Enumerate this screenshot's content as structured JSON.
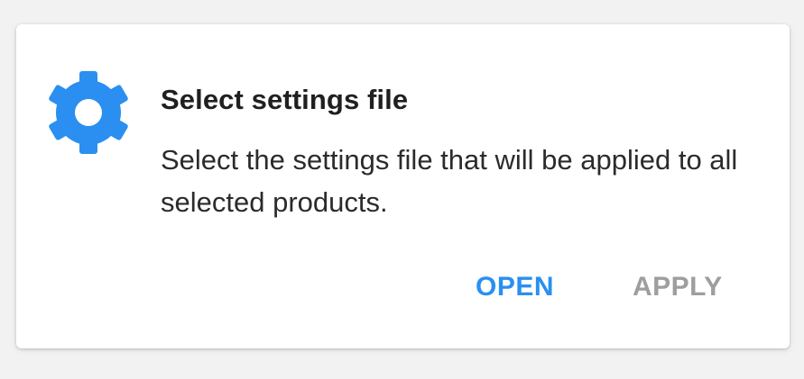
{
  "dialog": {
    "icon": "gear-icon",
    "title": "Select settings file",
    "message": "Select the settings file that will be applied to all selected products.",
    "buttons": {
      "open_label": "OPEN",
      "apply_label": "APPLY"
    }
  },
  "colors": {
    "accent": "#2a8ff0",
    "disabled": "#9e9e9e",
    "title_text": "#202020",
    "body_text": "#2b2b2b",
    "background": "#f2f2f2",
    "card": "#ffffff"
  }
}
